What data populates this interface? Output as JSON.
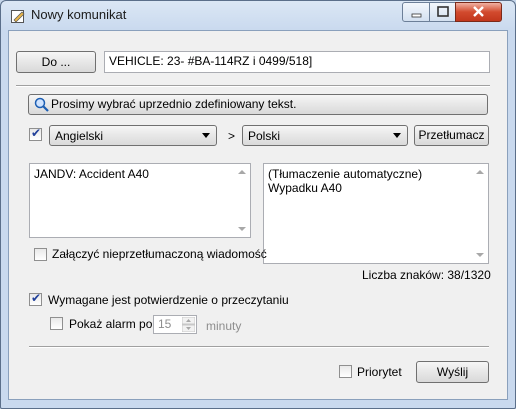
{
  "window": {
    "title": "Nowy komunikat"
  },
  "to": {
    "button": "Do ...",
    "value": "VEHICLE: 23- #BA-114RZ i 0499/518]"
  },
  "predefined_button": "Prosimy wybrać uprzednio zdefiniowany tekst.",
  "translation": {
    "enabled": true,
    "source_language": "Angielski",
    "arrow": ">",
    "target_language": "Polski",
    "translate_button": "Przetłumacz",
    "source_text": "JANDV: Accident A40",
    "target_text": "(Tłumaczenie automatyczne) Wypadku A40",
    "attach_untranslated_label": "Załączyć nieprzetłumaczoną wiadomość",
    "attach_untranslated_checked": false,
    "char_count": "Liczba znaków: 38/1320"
  },
  "confirmation": {
    "label": "Wymagane jest potwierdzenie o przeczytaniu",
    "checked": true,
    "alarm_label": "Pokaż alarm po",
    "alarm_checked": false,
    "alarm_value": "15",
    "alarm_unit": "minuty"
  },
  "footer": {
    "priority_label": "Priorytet",
    "priority_checked": false,
    "send_button": "Wyślij"
  },
  "icons": [
    "message-edit-icon",
    "minimize-icon",
    "maximize-icon",
    "close-icon",
    "magnifier-icon",
    "scroll-up-icon",
    "scroll-down-icon",
    "chevron-down-icon"
  ]
}
